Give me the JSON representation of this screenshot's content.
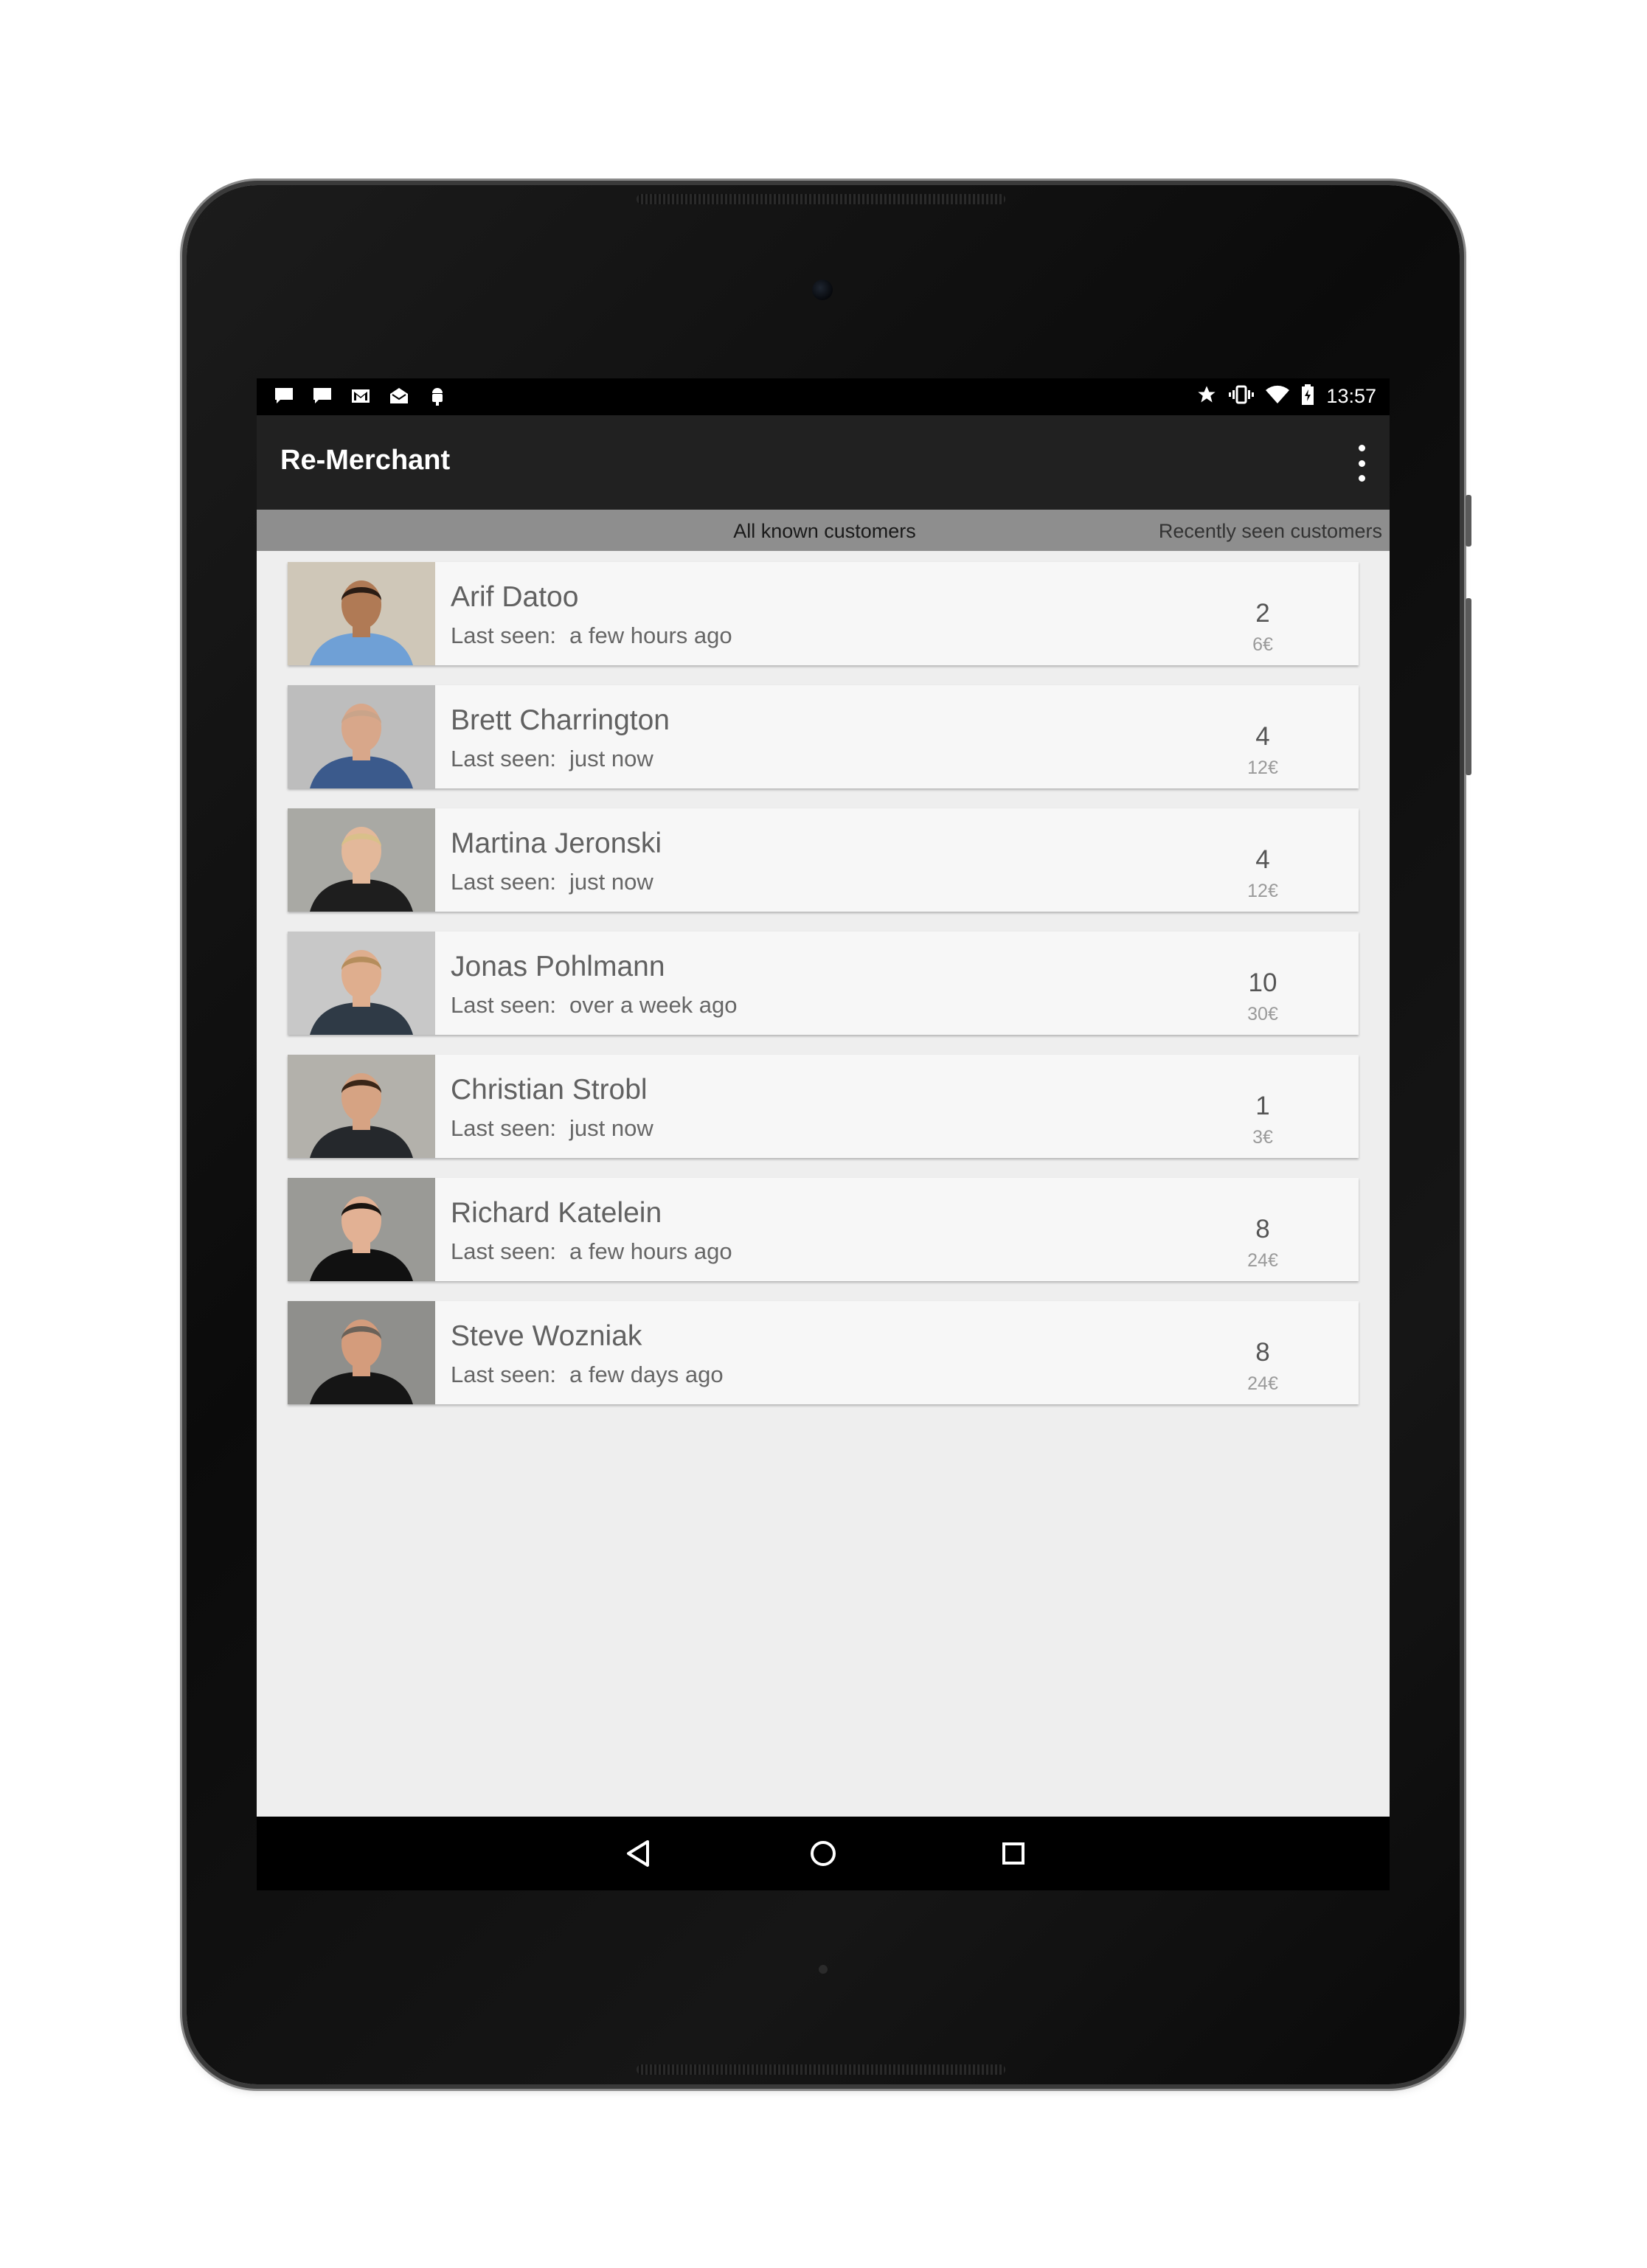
{
  "status_bar": {
    "time": "13:57",
    "left_icons": [
      "chat-icon",
      "chat-icon",
      "gmail-icon",
      "mail-icon",
      "android-icon"
    ],
    "right_icons": [
      "star-icon",
      "vibrate-icon",
      "wifi-icon",
      "battery-charging-icon"
    ]
  },
  "app_bar": {
    "title": "Re-Merchant",
    "menu_icon": "overflow-menu-icon"
  },
  "tabs": {
    "all": "All known customers",
    "recent": "Recently seen customers"
  },
  "customers_label": "Last seen:",
  "customers": [
    {
      "name": "Arif Datoo",
      "last_seen": "a few hours ago",
      "count": "2",
      "amount": "6€",
      "bg": "#cfc7b8",
      "shirt": "#6fa0d6",
      "skin": "#b07a55",
      "hair": "#2a1c14"
    },
    {
      "name": "Brett Charrington",
      "last_seen": "just now",
      "count": "4",
      "amount": "12€",
      "bg": "#bdbdbd",
      "shirt": "#3b5a8c",
      "skin": "#d8a78a",
      "hair": "#c9a48a"
    },
    {
      "name": "Martina Jeronski",
      "last_seen": "just now",
      "count": "4",
      "amount": "12€",
      "bg": "#a9a9a4",
      "shirt": "#1e1e1e",
      "skin": "#e3b89a",
      "hair": "#d9c08a"
    },
    {
      "name": "Jonas Pohlmann",
      "last_seen": "over a week ago",
      "count": "10",
      "amount": "30€",
      "bg": "#c8c8c8",
      "shirt": "#2f3a46",
      "skin": "#dfae8e",
      "hair": "#b58d5c"
    },
    {
      "name": "Christian Strobl",
      "last_seen": "just now",
      "count": "1",
      "amount": "3€",
      "bg": "#b3b1ab",
      "shirt": "#25282c",
      "skin": "#d6a383",
      "hair": "#3a2618"
    },
    {
      "name": "Richard Katelein",
      "last_seen": "a few hours ago",
      "count": "8",
      "amount": "24€",
      "bg": "#9a9a96",
      "shirt": "#111111",
      "skin": "#e2b194",
      "hair": "#1b1511"
    },
    {
      "name": "Steve Wozniak",
      "last_seen": "a few days ago",
      "count": "8",
      "amount": "24€",
      "bg": "#8f8f8c",
      "shirt": "#151515",
      "skin": "#d49c7c",
      "hair": "#6b6259"
    }
  ],
  "nav": {
    "back_icon": "back-icon",
    "home_icon": "home-icon",
    "recents_icon": "recents-icon"
  }
}
